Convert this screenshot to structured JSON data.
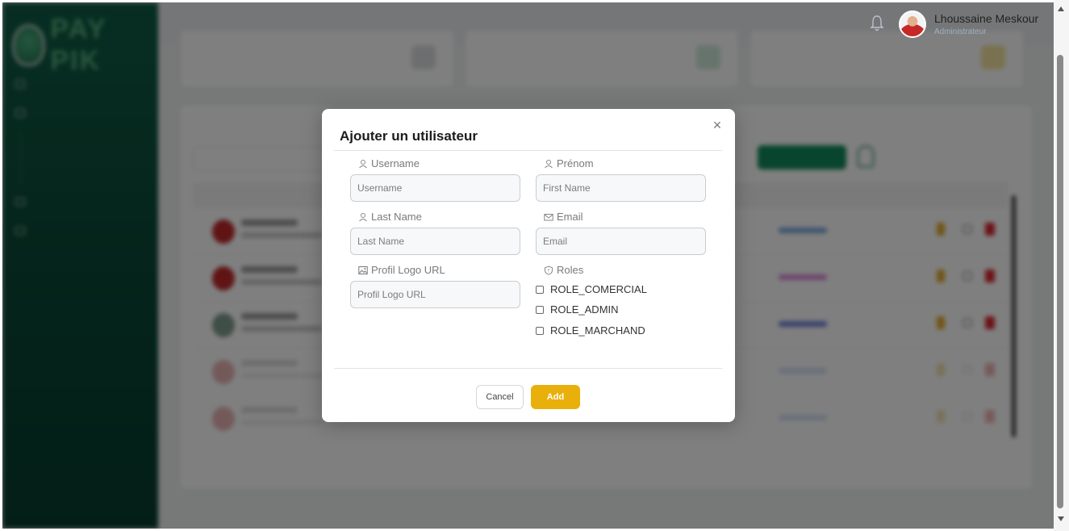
{
  "header": {
    "user_name": "Lhoussaine Meskour",
    "user_role": "Administrateur"
  },
  "modal": {
    "title": "Ajouter un utilisateur",
    "fields": {
      "username": {
        "label": "Username",
        "placeholder": "Username",
        "value": ""
      },
      "prenom": {
        "label": "Prénom",
        "placeholder": "First Name",
        "value": ""
      },
      "last_name": {
        "label": "Last Name",
        "placeholder": "Last Name",
        "value": ""
      },
      "email": {
        "label": "Email",
        "placeholder": "Email",
        "value": ""
      },
      "profil_logo_url": {
        "label": "Profil Logo URL",
        "placeholder": "Profil Logo URL",
        "value": ""
      }
    },
    "roles_label": "Roles",
    "roles": [
      {
        "label": "ROLE_COMERCIAL",
        "checked": false
      },
      {
        "label": "ROLE_ADMIN",
        "checked": false
      },
      {
        "label": "ROLE_MARCHAND",
        "checked": false
      }
    ],
    "cancel_label": "Cancel",
    "add_label": "Add"
  },
  "colors": {
    "sidebar": "#0b4f3a",
    "add_button": "#e9b00b",
    "overlay": "rgba(0,0,0,0.5)"
  },
  "icons": {
    "close": "close-icon",
    "user": "user-icon",
    "email": "envelope-icon",
    "image": "image-icon",
    "roles": "shield-icon",
    "bell": "bell-icon"
  }
}
